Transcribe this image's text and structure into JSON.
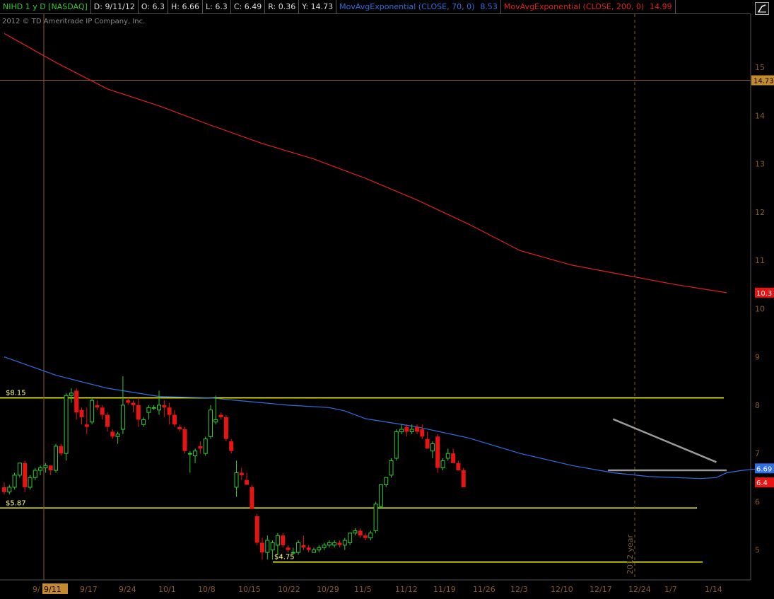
{
  "header": {
    "symbol": "NIHD 1 y D [NASDAQ]",
    "date": "D: 9/11/12",
    "open": "O: 6.3",
    "high": "H: 6.66",
    "low": "L: 6.3",
    "close": "C: 6.49",
    "range": "R: 0.36",
    "y": "Y: 14.73",
    "ema70_label": "MovAvgExponential (CLOSE, 70, 0)",
    "ema70_value": "8.53",
    "ema200_label": "MovAvgExponential (CLOSE, 200, 0)",
    "ema200_value": "14.99",
    "copyright": "2012 © TD Ameritrade IP Company, Inc."
  },
  "colors": {
    "up": "#2ecc2e",
    "down": "#e81414",
    "ema70": "#2f6fe0",
    "ema200": "#e02020",
    "support": "#ffff00",
    "trend": "#9a9a9a",
    "axis_text": "#8b5a2b",
    "crosshair": "#8b5a2b"
  },
  "chart_data": {
    "type": "candlestick",
    "ylim": [
      4.38,
      16.1
    ],
    "y_ticks": [
      5,
      6,
      7,
      8,
      9,
      10,
      11,
      12,
      13,
      14,
      15
    ],
    "x_tick_labels": [
      "9/",
      "9/11",
      "9/17",
      "9/24",
      "10/1",
      "10/8",
      "10/15",
      "10/22",
      "10/29",
      "11/5",
      "11/12",
      "11/19",
      "11/26",
      "12/3",
      "12/10",
      "12/17",
      "12/24",
      "1/7",
      "1/14"
    ],
    "crosshair": {
      "date_label": "9/11",
      "price_label": "14.73",
      "price": 14.73
    },
    "year_marker": {
      "label": "2012 year"
    },
    "price_badges": [
      {
        "label": "6.69",
        "value": 6.69,
        "color": "#2f6fe0"
      },
      {
        "label": "6.4",
        "value": 6.4,
        "color": "#e81414"
      },
      {
        "label": "10.3",
        "value": 10.33,
        "color": "#e81414"
      }
    ],
    "horizontal_levels": [
      {
        "label": "$8.15",
        "value": 8.15
      },
      {
        "label": "$5.87",
        "value": 5.87
      },
      {
        "label": "$4.75",
        "value": 4.75
      }
    ],
    "trendlines": [
      {
        "from": [
          118,
          7.71
        ],
        "to": [
          138,
          6.82
        ]
      },
      {
        "from": [
          117,
          6.65
        ],
        "to": [
          140,
          6.65
        ]
      }
    ],
    "candles": [
      [
        6.3,
        6.4,
        6.15,
        6.2
      ],
      [
        6.2,
        6.35,
        6.15,
        6.3
      ],
      [
        6.3,
        6.6,
        6.25,
        6.55
      ],
      [
        6.55,
        6.8,
        6.5,
        6.8
      ],
      [
        6.8,
        6.85,
        6.2,
        6.3
      ],
      [
        6.3,
        6.55,
        6.25,
        6.5
      ],
      [
        6.5,
        6.7,
        6.45,
        6.65
      ],
      [
        6.65,
        6.75,
        6.55,
        6.7
      ],
      [
        6.7,
        6.8,
        6.6,
        6.75
      ],
      [
        6.75,
        6.7,
        6.55,
        6.65
      ],
      [
        6.65,
        7.2,
        6.6,
        7.15
      ],
      [
        7.15,
        7.2,
        6.95,
        7.0
      ],
      [
        7.0,
        8.25,
        6.85,
        8.2
      ],
      [
        8.2,
        8.35,
        8.05,
        8.25
      ],
      [
        8.3,
        8.35,
        7.7,
        7.85
      ],
      [
        7.9,
        7.95,
        7.6,
        7.75
      ],
      [
        7.6,
        7.95,
        7.4,
        7.55
      ],
      [
        7.65,
        8.15,
        7.6,
        8.1
      ],
      [
        8.0,
        8.1,
        7.9,
        7.95
      ],
      [
        7.95,
        8.0,
        7.7,
        7.8
      ],
      [
        7.8,
        7.85,
        7.45,
        7.55
      ],
      [
        7.45,
        7.5,
        7.3,
        7.35
      ],
      [
        7.35,
        7.45,
        7.2,
        7.4
      ],
      [
        7.5,
        8.6,
        7.4,
        8.0
      ],
      [
        8.1,
        8.15,
        8.0,
        8.05
      ],
      [
        8.05,
        8.1,
        7.85,
        8.0
      ],
      [
        8.0,
        8.15,
        7.55,
        7.7
      ],
      [
        7.6,
        7.75,
        7.55,
        7.7
      ],
      [
        7.85,
        8.0,
        7.7,
        7.95
      ],
      [
        7.95,
        8.0,
        7.9,
        7.95
      ],
      [
        7.9,
        8.3,
        7.8,
        8.0
      ],
      [
        8.0,
        8.1,
        7.75,
        7.95
      ],
      [
        7.95,
        8.05,
        7.6,
        7.8
      ],
      [
        7.8,
        7.9,
        7.55,
        7.6
      ],
      [
        7.55,
        7.6,
        7.45,
        7.5
      ],
      [
        7.5,
        7.55,
        7.0,
        7.05
      ],
      [
        7.0,
        7.05,
        6.6,
        7.0
      ],
      [
        6.95,
        7.1,
        6.8,
        7.05
      ],
      [
        7.15,
        7.25,
        7.0,
        7.1
      ],
      [
        7.0,
        7.35,
        6.95,
        7.3
      ],
      [
        7.35,
        8.0,
        7.3,
        7.9
      ],
      [
        7.65,
        8.2,
        7.6,
        7.7
      ],
      [
        7.8,
        7.85,
        7.7,
        7.75
      ],
      [
        7.75,
        7.8,
        7.25,
        7.3
      ],
      [
        7.25,
        7.3,
        7.0,
        7.05
      ],
      [
        6.3,
        6.85,
        6.1,
        6.6
      ],
      [
        6.6,
        6.7,
        6.45,
        6.55
      ],
      [
        6.45,
        6.6,
        6.35,
        6.35
      ],
      [
        6.3,
        6.35,
        5.85,
        5.85
      ],
      [
        5.7,
        5.75,
        5.1,
        5.15
      ],
      [
        5.15,
        5.25,
        4.8,
        4.95
      ],
      [
        4.95,
        5.3,
        4.8,
        5.2
      ],
      [
        5.0,
        5.2,
        4.8,
        5.15
      ],
      [
        5.1,
        5.35,
        4.9,
        5.3
      ],
      [
        5.3,
        5.35,
        5.05,
        5.1
      ],
      [
        5.05,
        5.1,
        4.95,
        5.0
      ],
      [
        4.95,
        5.05,
        4.9,
        4.95
      ],
      [
        4.95,
        5.2,
        4.9,
        5.15
      ],
      [
        5.1,
        5.3,
        5.0,
        5.05
      ],
      [
        5.05,
        5.1,
        4.95,
        5.0
      ],
      [
        4.95,
        5.05,
        4.95,
        5.0
      ],
      [
        5.0,
        5.1,
        4.95,
        5.05
      ],
      [
        5.05,
        5.15,
        5.0,
        5.1
      ],
      [
        5.1,
        5.2,
        5.05,
        5.15
      ],
      [
        5.1,
        5.2,
        5.05,
        5.15
      ],
      [
        5.15,
        5.2,
        5.05,
        5.1
      ],
      [
        5.1,
        5.25,
        5.0,
        5.2
      ],
      [
        5.15,
        5.35,
        5.1,
        5.35
      ],
      [
        5.35,
        5.45,
        5.3,
        5.4
      ],
      [
        5.4,
        5.45,
        5.25,
        5.3
      ],
      [
        5.3,
        5.35,
        5.2,
        5.25
      ],
      [
        5.25,
        5.4,
        5.2,
        5.35
      ],
      [
        5.4,
        6.0,
        5.35,
        5.95
      ],
      [
        5.9,
        6.35,
        5.85,
        6.35
      ],
      [
        6.35,
        6.5,
        6.3,
        6.5
      ],
      [
        6.55,
        6.9,
        6.5,
        6.85
      ],
      [
        6.9,
        7.5,
        6.85,
        7.45
      ],
      [
        7.45,
        7.6,
        7.4,
        7.5
      ],
      [
        7.55,
        7.6,
        7.35,
        7.45
      ],
      [
        7.45,
        7.6,
        7.4,
        7.5
      ],
      [
        7.55,
        7.6,
        7.4,
        7.45
      ],
      [
        7.5,
        7.6,
        7.3,
        7.35
      ],
      [
        7.3,
        7.45,
        7.1,
        7.1
      ],
      [
        7.05,
        7.25,
        6.9,
        7.2
      ],
      [
        7.35,
        7.4,
        6.6,
        6.7
      ],
      [
        6.7,
        6.9,
        6.65,
        6.85
      ],
      [
        6.9,
        7.1,
        6.85,
        7.0
      ],
      [
        7.0,
        7.1,
        6.85,
        6.8
      ],
      [
        6.8,
        6.85,
        6.75,
        6.65
      ],
      [
        6.65,
        6.7,
        6.35,
        6.3
      ]
    ],
    "ema70": [
      [
        0,
        9.0
      ],
      [
        10,
        8.62
      ],
      [
        20,
        8.35
      ],
      [
        30,
        8.18
      ],
      [
        40,
        8.15
      ],
      [
        45,
        8.1
      ],
      [
        55,
        8.0
      ],
      [
        63,
        7.95
      ],
      [
        66,
        7.88
      ],
      [
        70,
        7.72
      ],
      [
        80,
        7.55
      ],
      [
        90,
        7.32
      ],
      [
        100,
        7.0
      ],
      [
        110,
        6.75
      ],
      [
        118,
        6.6
      ],
      [
        125,
        6.52
      ],
      [
        135,
        6.48
      ],
      [
        138,
        6.5
      ],
      [
        140,
        6.6
      ],
      [
        143,
        6.65
      ],
      [
        146,
        6.68
      ],
      [
        150,
        6.6
      ]
    ],
    "ema200": [
      [
        0,
        15.7
      ],
      [
        10,
        15.1
      ],
      [
        20,
        14.55
      ],
      [
        30,
        14.2
      ],
      [
        40,
        13.8
      ],
      [
        50,
        13.42
      ],
      [
        60,
        13.1
      ],
      [
        70,
        12.7
      ],
      [
        80,
        12.25
      ],
      [
        90,
        11.75
      ],
      [
        100,
        11.2
      ],
      [
        110,
        10.9
      ],
      [
        120,
        10.7
      ],
      [
        130,
        10.5
      ],
      [
        140,
        10.33
      ]
    ]
  }
}
